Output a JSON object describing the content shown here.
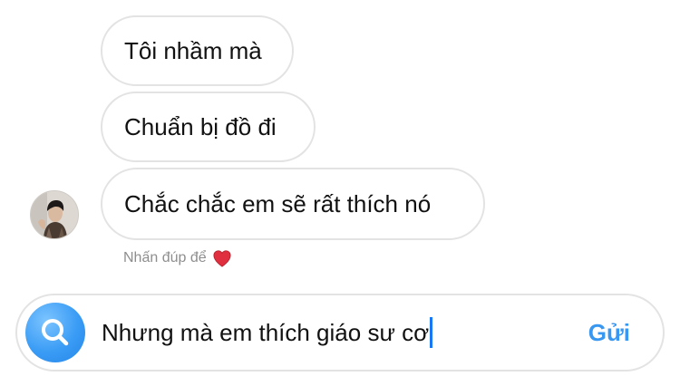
{
  "messages": [
    {
      "text": "Tôi nhầm mà"
    },
    {
      "text": "Chuẩn bị đồ đi"
    },
    {
      "text": "Chắc chắc em sẽ rất thích nó"
    }
  ],
  "hint": {
    "text": "Nhấn đúp để",
    "icon": "heart-icon",
    "icon_color": "#e0303f"
  },
  "composer": {
    "search_icon": "search-icon",
    "draft_text": "Nhưng mà em thích giáo sư cơ",
    "send_label": "Gửi"
  },
  "colors": {
    "accent": "#3897f0",
    "bubble_border": "#e3e3e3",
    "caret": "#1877f2"
  }
}
